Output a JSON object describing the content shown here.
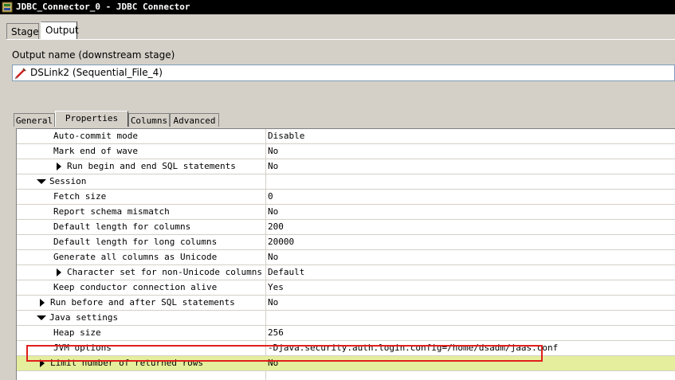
{
  "window": {
    "title": "JDBC_Connector_0 - JDBC Connector",
    "icon": "connector-stage-icon"
  },
  "stage_tabs": [
    {
      "label": "Stage",
      "active": false
    },
    {
      "label": "Output",
      "active": true
    }
  ],
  "output": {
    "label": "Output name (downstream stage)",
    "selected": "DSLink2 (Sequential_File_4)",
    "icon": "link-icon"
  },
  "property_tabs": [
    {
      "label": "General",
      "active": false
    },
    {
      "label": "Properties",
      "active": true
    },
    {
      "label": "Columns",
      "active": false
    },
    {
      "label": "Advanced",
      "active": false
    }
  ],
  "properties": [
    {
      "name": "Auto-commit mode",
      "value": "Disable"
    },
    {
      "name": "Mark end of wave",
      "value": "No"
    },
    {
      "name": "Run begin and end SQL statements",
      "value": "No",
      "expander": "collapsed"
    },
    {
      "name": "Session",
      "value": "",
      "expander": "expanded"
    },
    {
      "name": "Fetch size",
      "value": "0"
    },
    {
      "name": "Report schema mismatch",
      "value": "No"
    },
    {
      "name": "Default length for columns",
      "value": "200"
    },
    {
      "name": "Default length for long columns",
      "value": "20000"
    },
    {
      "name": "Generate all columns as Unicode",
      "value": "No"
    },
    {
      "name": "Character set for non-Unicode columns",
      "value": "Default",
      "expander": "collapsed"
    },
    {
      "name": "Keep conductor connection alive",
      "value": "Yes"
    },
    {
      "name": "Run before and after SQL statements",
      "value": "No",
      "expander": "collapsed"
    },
    {
      "name": "Java settings",
      "value": "",
      "expander": "expanded"
    },
    {
      "name": "Heap size",
      "value": "256"
    },
    {
      "name": "JVM options",
      "value": "-Djava.security.auth.login.config=/home/dsadm/jaas.conf",
      "annotated": true
    },
    {
      "name": "Limit number of returned rows",
      "value": "No",
      "expander": "collapsed",
      "highlighted": true
    }
  ],
  "colors": {
    "highlight_row": "#e4ee9c",
    "annotation_box": "#e0201c",
    "title_bar": "#000000",
    "dialog_bg": "#d4d0c8"
  }
}
